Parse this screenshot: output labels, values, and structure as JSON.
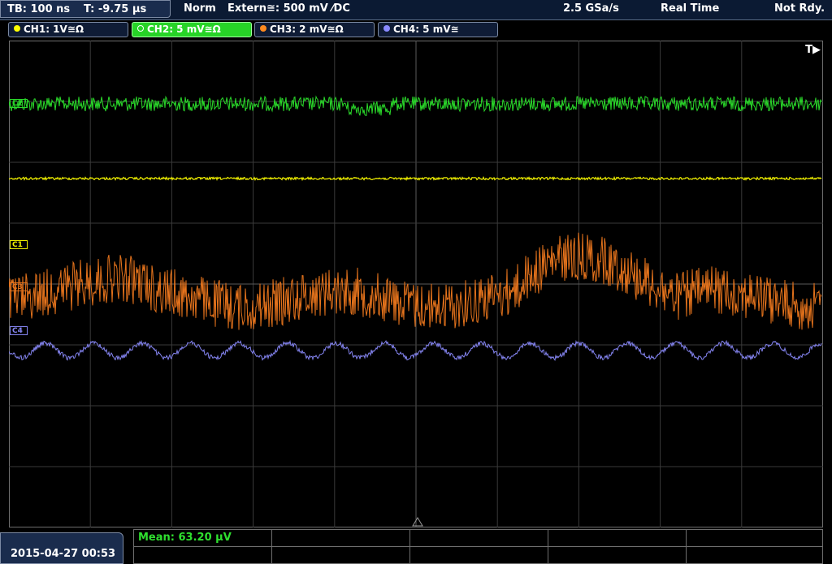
{
  "status_bar": {
    "timebase": "TB: 100 ns",
    "trigger_time": "T: -9.75 µs",
    "trigger_mode": "Norm",
    "trigger_source": "Extern≅: 500 mV ⁄DC",
    "sample_rate": "2.5 GSa/s",
    "acq_mode": "Real Time",
    "state": "Not Rdy."
  },
  "channels": [
    {
      "label": "CH1: 1V≅Ω",
      "color": "#ffff00",
      "active": false
    },
    {
      "label": "CH2: 5 mV≅Ω",
      "color": "#2fe02f",
      "active": true
    },
    {
      "label": "CH3: 2 mV≅Ω",
      "color": "#ff8a1f",
      "active": false
    },
    {
      "label": "CH4: 5 mV≅",
      "color": "#8a8aff",
      "active": false
    }
  ],
  "markers": {
    "trigger_position": "T▶",
    "c1": "C1",
    "c2": "C2",
    "c3": "C3",
    "c4": "C4"
  },
  "footer": {
    "datetime": "2015-04-27 00:53",
    "measurement": "Mean: 63.20 µV"
  },
  "colors": {
    "ch1": "#f2f200",
    "ch2": "#2ad82a",
    "ch3": "#e5731c",
    "ch4": "#8484f0",
    "grid": "#4a4a4a"
  }
}
